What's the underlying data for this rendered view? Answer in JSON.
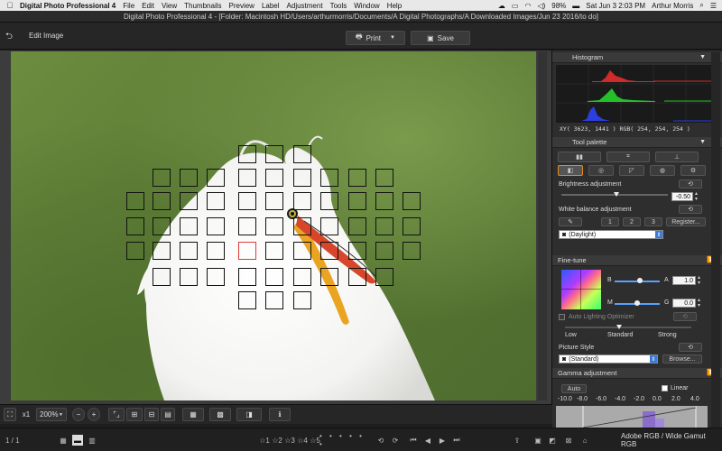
{
  "menubar": {
    "app_name": "Digital Photo Professional 4",
    "items": [
      "File",
      "Edit",
      "View",
      "Thumbnails",
      "Preview",
      "Label",
      "Adjustment",
      "Tools",
      "Window",
      "Help"
    ],
    "battery": "98%",
    "datetime": "Sat Jun 3  2:03 PM",
    "user": "Arthur Morris"
  },
  "window_title": "Digital Photo Professional 4 - [Folder: Macintosh HD/Users/arthurmorris/Documents/A Digital Photographs/A Downloaded Images/Jun 23 2016/to do]",
  "toolbar": {
    "mode_label": "Edit Image",
    "print_label": "Print",
    "save_label": "Save"
  },
  "viewbar": {
    "zoom_x1": "x1",
    "zoom_value": "200%"
  },
  "statusbar": {
    "page_count": "1 / 1",
    "ratings": [
      "☆1",
      "☆2",
      "☆3",
      "☆4",
      "☆5"
    ],
    "color_space": "Adobe RGB / Wide Gamut RGB"
  },
  "histogram": {
    "title": "Histogram",
    "readout": "XY( 3623,  1441 ) RGB( 254,  254,  254 )"
  },
  "tool_palette": {
    "title": "Tool palette",
    "brightness_label": "Brightness adjustment",
    "brightness_value": "-0.50",
    "brightness_level": 0.45,
    "white_balance_label": "White balance adjustment",
    "wb_presets": [
      "1",
      "2",
      "3"
    ],
    "register_label": "Register...",
    "wb_selected": "(Daylight)"
  },
  "fine_tune": {
    "title": "Fine-tune",
    "b_label": "B",
    "a_label": "A",
    "a_value": "1.0",
    "m_label": "M",
    "g_label": "G",
    "g_value": "0.0",
    "alo_label": "Auto Lighting Optimizer",
    "alo_levels": [
      "Low",
      "Standard",
      "Strong"
    ],
    "picture_style_label": "Picture Style",
    "picture_style_value": "(Standard)",
    "browse_label": "Browse..."
  },
  "gamma": {
    "title": "Gamma adjustment",
    "auto_label": "Auto",
    "linear_label": "Linear",
    "scale": [
      "-10.0",
      "-8.0",
      "-6.0",
      "-4.0",
      "-2.0",
      "0.0",
      "2.0",
      "4.0"
    ]
  },
  "colors": {
    "accent": "#3b7bd8",
    "af_selected": "#e03a3a",
    "panel_bg": "#2e2e2e"
  }
}
